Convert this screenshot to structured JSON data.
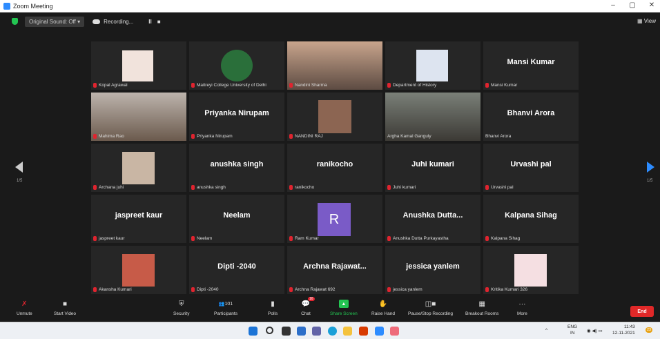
{
  "window": {
    "title": "Zoom Meeting",
    "min": "–",
    "restore": "▢",
    "close": "✕"
  },
  "topbar": {
    "original_sound": "Original Sound: Off",
    "recording": "Recording...",
    "pause": "II",
    "stop": "■",
    "view": "View"
  },
  "nav": {
    "page_left": "1/5",
    "page_right": "1/5"
  },
  "tiles": [
    {
      "label": "Kopal Agrawal",
      "display": "",
      "muted": true
    },
    {
      "label": "Maitreyi College University of Delhi",
      "display": "",
      "muted": true
    },
    {
      "label": "Nandini Sharma",
      "display": "",
      "muted": true
    },
    {
      "label": "Department of History",
      "display": "",
      "muted": true
    },
    {
      "label": "Mansi Kumar",
      "display": "Mansi Kumar",
      "muted": true
    },
    {
      "label": "Mahima Rao",
      "display": "",
      "muted": true
    },
    {
      "label": "Priyanka Nirupam",
      "display": "Priyanka Nirupam",
      "muted": true
    },
    {
      "label": "NANDINI RAJ",
      "display": "",
      "muted": true
    },
    {
      "label": "Argha Kamal Ganguly",
      "display": "",
      "muted": false
    },
    {
      "label": "Bhanvi Arora",
      "display": "Bhanvi Arora",
      "muted": false
    },
    {
      "label": "Archana juhi",
      "display": "",
      "muted": true
    },
    {
      "label": "anushka singh",
      "display": "anushka singh",
      "muted": true
    },
    {
      "label": "ranikocho",
      "display": "ranikocho",
      "muted": true
    },
    {
      "label": "Juhi kumari",
      "display": "Juhi kumari",
      "muted": true
    },
    {
      "label": "Urvashi pal",
      "display": "Urvashi pal",
      "muted": true
    },
    {
      "label": "jaspreet kaur",
      "display": "jaspreet kaur",
      "muted": true
    },
    {
      "label": "Neelam",
      "display": "Neelam",
      "muted": true
    },
    {
      "label": "Ram Kumar",
      "display": "",
      "avatar": "R",
      "muted": true
    },
    {
      "label": "Anushka Dutta Purkayastha",
      "display": "Anushka Dutta...",
      "muted": true
    },
    {
      "label": "Kalpana Sihag",
      "display": "Kalpana Sihag",
      "muted": true
    },
    {
      "label": "Akansha Kumari",
      "display": "",
      "muted": true
    },
    {
      "label": "Dipti -2040",
      "display": "Dipti -2040",
      "muted": true
    },
    {
      "label": "Archna Rajawat 692",
      "display": "Archna Rajawat...",
      "muted": true
    },
    {
      "label": "jessica yanlem",
      "display": "jessica yanlem",
      "muted": true
    },
    {
      "label": "Kritika Kumari 326",
      "display": "",
      "muted": true
    }
  ],
  "toolbar": {
    "unmute": "Unmute",
    "start_video": "Start Video",
    "security": "Security",
    "participants": "Participants",
    "participants_count": "101",
    "polls": "Polls",
    "chat": "Chat",
    "chat_badge": "16",
    "share_screen": "Share Screen",
    "raise_hand": "Raise Hand",
    "pause_rec": "Pause/Stop Recording",
    "breakout": "Breakout Rooms",
    "more": "More",
    "end": "End"
  },
  "taskbar": {
    "lang1": "ENG",
    "lang2": "IN",
    "time": "11:43",
    "date": "12-11-2021",
    "notif": "23"
  },
  "colors": {
    "accent": "#2d8cff",
    "mute_red": "#e0242f",
    "active_border": "#a8d431",
    "share_green": "#23c552",
    "end_red": "#e02828"
  }
}
